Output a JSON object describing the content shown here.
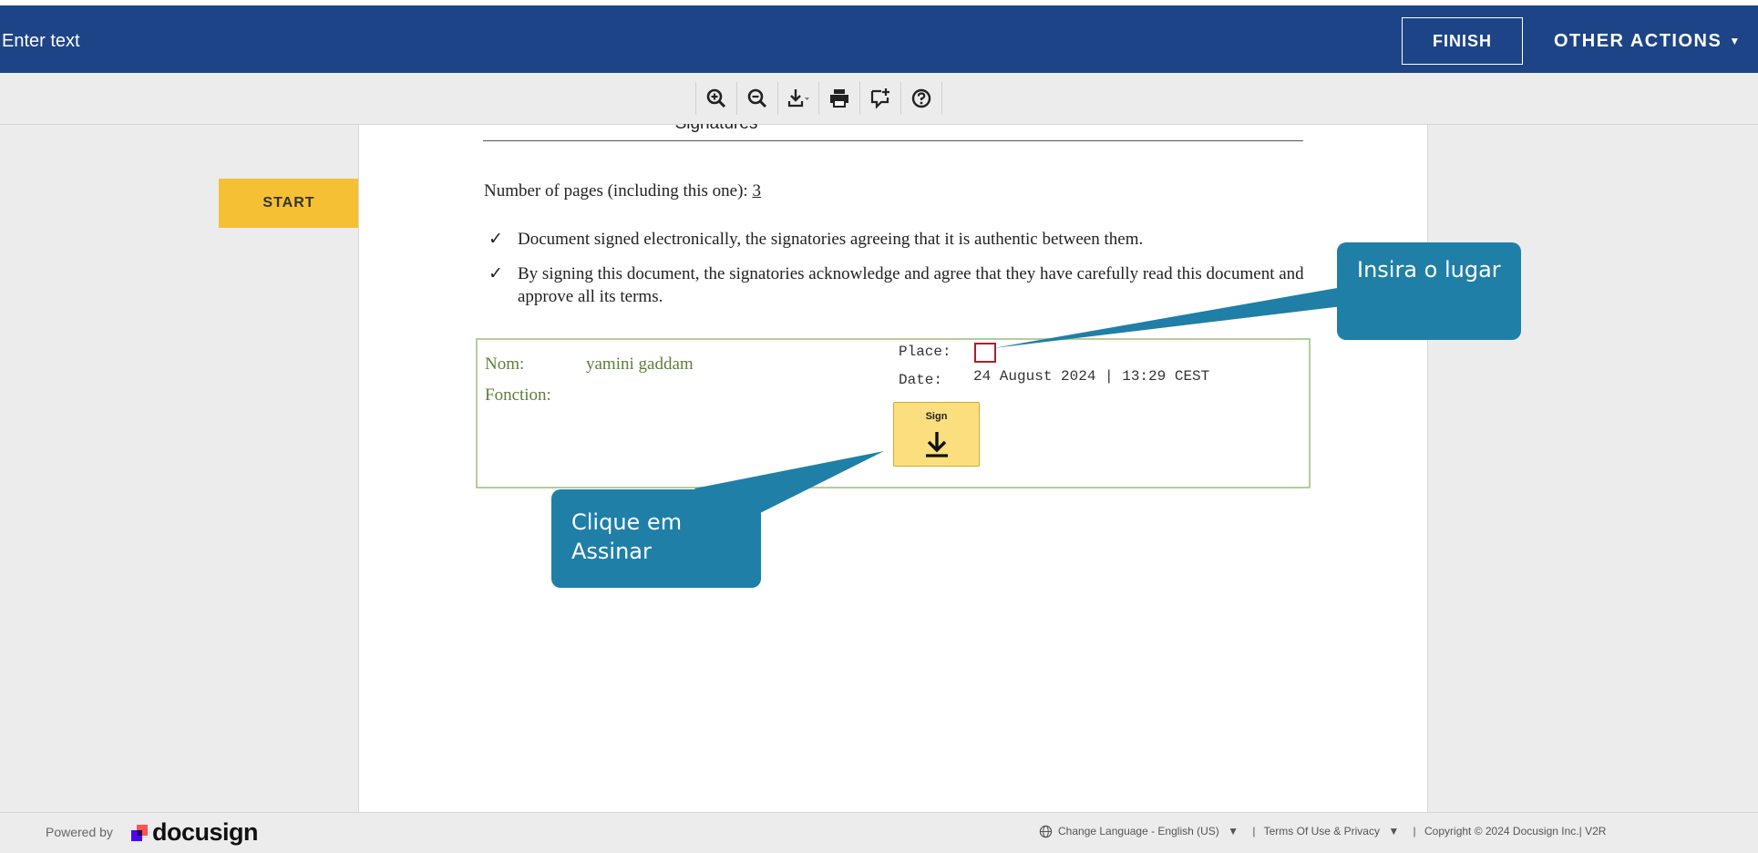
{
  "header": {
    "title": "Enter text",
    "finish_label": "FINISH",
    "other_actions_label": "OTHER ACTIONS",
    "background": "#1d4487"
  },
  "toolbar": {
    "icons": [
      "zoom-in-icon",
      "zoom-out-icon",
      "download-icon",
      "print-icon",
      "comment-icon",
      "help-icon"
    ]
  },
  "sidebar": {
    "start_label": "START",
    "accent": "#f5c033"
  },
  "document": {
    "heading": "Signatures",
    "pages_prefix": "Number of pages (including this one): ",
    "pages_count": "3",
    "bullets": [
      "Document signed electronically, the signatories agreeing that it is authentic between them.",
      "By signing this document, the signatories acknowledge and agree that they have carefully read this document and approve all its terms."
    ],
    "signature": {
      "nom_label": "Nom:",
      "nom_value": "yamini gaddam",
      "fonction_label": "Fonction:",
      "place_label": "Place:",
      "date_label": "Date:",
      "date_value": "24 August 2024 | 13:29 CEST",
      "sign_label": "Sign"
    }
  },
  "callouts": {
    "place": "Insira o lugar",
    "sign": "Clique em Assinar",
    "color": "#1f7fa7"
  },
  "footer": {
    "powered_by": "Powered by",
    "brand": "docusign",
    "change_language": "Change Language - English (US)",
    "terms": "Terms Of Use & Privacy",
    "copyright": "Copyright © 2024 Docusign Inc.| V2R"
  }
}
